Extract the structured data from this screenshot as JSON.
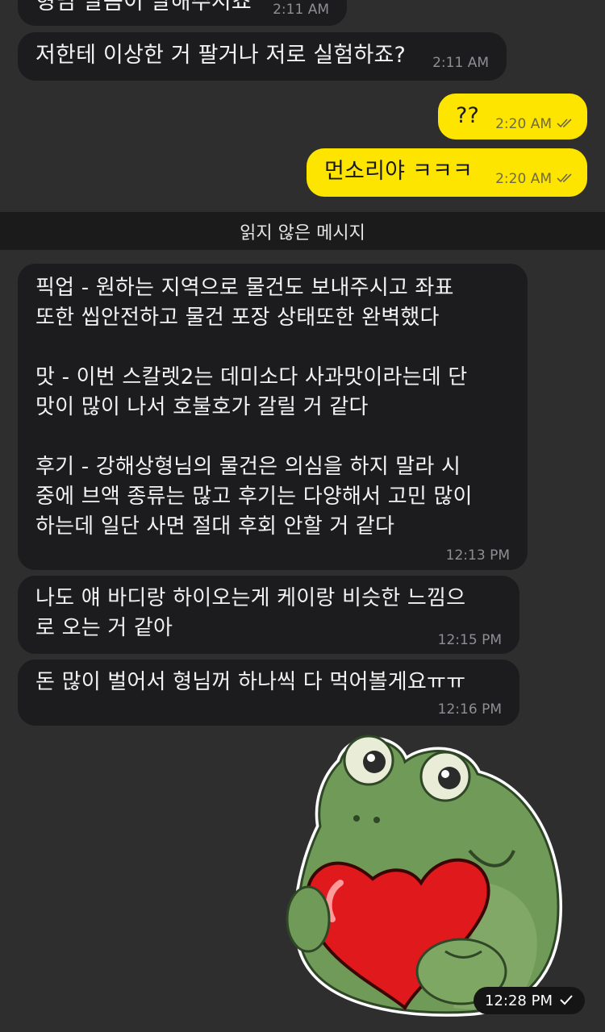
{
  "messages": [
    {
      "id": "m0",
      "dir": "in",
      "text": "형님 말씀이 말해주시죠",
      "time": "2:11 AM"
    },
    {
      "id": "m1",
      "dir": "in",
      "text": "저한테 이상한 거 팔거나 저로 실험하죠?",
      "time": "2:11 AM"
    },
    {
      "id": "m2",
      "dir": "out",
      "text": "??",
      "time": "2:20 AM",
      "status": "read"
    },
    {
      "id": "m3",
      "dir": "out",
      "text": "먼소리야 ㅋㅋㅋ",
      "time": "2:20 AM",
      "status": "read"
    },
    {
      "id": "m4",
      "dir": "in",
      "text": "픽업 - 원하는 지역으로 물건도 보내주시고 좌표\n또한 씹안전하고 물건 포장 상태또한 완벽했다\n\n맛 - 이번 스칼렛2는 데미소다 사과맛이라는데 단\n맛이 많이 나서 호불호가 갈릴 거 같다\n\n후기 - 강해상형님의 물건은 의심을 하지 말라 시\n중에 브액 종류는 많고 후기는 다양해서 고민 많이\n하는데 일단 사면 절대 후회 안할 거 같다",
      "time": "12:13 PM"
    },
    {
      "id": "m5",
      "dir": "in",
      "text": "나도 얘 바디랑 하이오는게 케이랑 비슷한 느낌으\n로 오는 거 같아",
      "time": "12:15 PM"
    },
    {
      "id": "m6",
      "dir": "in",
      "text": "돈 많이 벌어서 형님꺼 하나씩 다 먹어볼게요ㅠㅠ",
      "time": "12:16 PM"
    }
  ],
  "divider": {
    "label": "읽지 않은 메시지"
  },
  "sticker": {
    "icon": "frog-heart-sticker",
    "time": "12:28 PM",
    "status": "sent"
  },
  "colors": {
    "background": "#2e2e2e",
    "incoming": "#1c1c1e",
    "outgoing": "#fee500"
  }
}
